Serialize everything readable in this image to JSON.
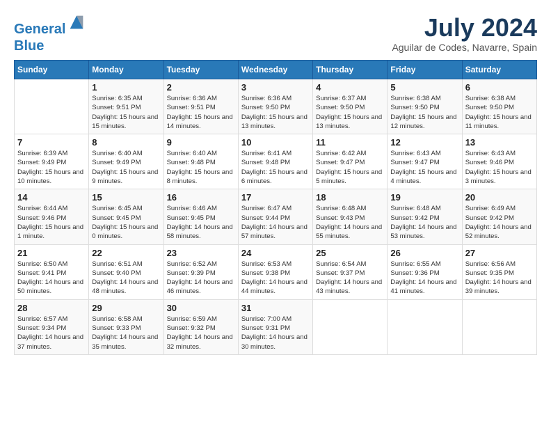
{
  "logo": {
    "line1": "General",
    "line2": "Blue"
  },
  "title": {
    "month_year": "July 2024",
    "location": "Aguilar de Codes, Navarre, Spain"
  },
  "weekdays": [
    "Sunday",
    "Monday",
    "Tuesday",
    "Wednesday",
    "Thursday",
    "Friday",
    "Saturday"
  ],
  "weeks": [
    [
      {
        "day": "",
        "sunrise": "",
        "sunset": "",
        "daylight": ""
      },
      {
        "day": "1",
        "sunrise": "Sunrise: 6:35 AM",
        "sunset": "Sunset: 9:51 PM",
        "daylight": "Daylight: 15 hours and 15 minutes."
      },
      {
        "day": "2",
        "sunrise": "Sunrise: 6:36 AM",
        "sunset": "Sunset: 9:51 PM",
        "daylight": "Daylight: 15 hours and 14 minutes."
      },
      {
        "day": "3",
        "sunrise": "Sunrise: 6:36 AM",
        "sunset": "Sunset: 9:50 PM",
        "daylight": "Daylight: 15 hours and 13 minutes."
      },
      {
        "day": "4",
        "sunrise": "Sunrise: 6:37 AM",
        "sunset": "Sunset: 9:50 PM",
        "daylight": "Daylight: 15 hours and 13 minutes."
      },
      {
        "day": "5",
        "sunrise": "Sunrise: 6:38 AM",
        "sunset": "Sunset: 9:50 PM",
        "daylight": "Daylight: 15 hours and 12 minutes."
      },
      {
        "day": "6",
        "sunrise": "Sunrise: 6:38 AM",
        "sunset": "Sunset: 9:50 PM",
        "daylight": "Daylight: 15 hours and 11 minutes."
      }
    ],
    [
      {
        "day": "7",
        "sunrise": "Sunrise: 6:39 AM",
        "sunset": "Sunset: 9:49 PM",
        "daylight": "Daylight: 15 hours and 10 minutes."
      },
      {
        "day": "8",
        "sunrise": "Sunrise: 6:40 AM",
        "sunset": "Sunset: 9:49 PM",
        "daylight": "Daylight: 15 hours and 9 minutes."
      },
      {
        "day": "9",
        "sunrise": "Sunrise: 6:40 AM",
        "sunset": "Sunset: 9:48 PM",
        "daylight": "Daylight: 15 hours and 8 minutes."
      },
      {
        "day": "10",
        "sunrise": "Sunrise: 6:41 AM",
        "sunset": "Sunset: 9:48 PM",
        "daylight": "Daylight: 15 hours and 6 minutes."
      },
      {
        "day": "11",
        "sunrise": "Sunrise: 6:42 AM",
        "sunset": "Sunset: 9:47 PM",
        "daylight": "Daylight: 15 hours and 5 minutes."
      },
      {
        "day": "12",
        "sunrise": "Sunrise: 6:43 AM",
        "sunset": "Sunset: 9:47 PM",
        "daylight": "Daylight: 15 hours and 4 minutes."
      },
      {
        "day": "13",
        "sunrise": "Sunrise: 6:43 AM",
        "sunset": "Sunset: 9:46 PM",
        "daylight": "Daylight: 15 hours and 3 minutes."
      }
    ],
    [
      {
        "day": "14",
        "sunrise": "Sunrise: 6:44 AM",
        "sunset": "Sunset: 9:46 PM",
        "daylight": "Daylight: 15 hours and 1 minute."
      },
      {
        "day": "15",
        "sunrise": "Sunrise: 6:45 AM",
        "sunset": "Sunset: 9:45 PM",
        "daylight": "Daylight: 15 hours and 0 minutes."
      },
      {
        "day": "16",
        "sunrise": "Sunrise: 6:46 AM",
        "sunset": "Sunset: 9:45 PM",
        "daylight": "Daylight: 14 hours and 58 minutes."
      },
      {
        "day": "17",
        "sunrise": "Sunrise: 6:47 AM",
        "sunset": "Sunset: 9:44 PM",
        "daylight": "Daylight: 14 hours and 57 minutes."
      },
      {
        "day": "18",
        "sunrise": "Sunrise: 6:48 AM",
        "sunset": "Sunset: 9:43 PM",
        "daylight": "Daylight: 14 hours and 55 minutes."
      },
      {
        "day": "19",
        "sunrise": "Sunrise: 6:48 AM",
        "sunset": "Sunset: 9:42 PM",
        "daylight": "Daylight: 14 hours and 53 minutes."
      },
      {
        "day": "20",
        "sunrise": "Sunrise: 6:49 AM",
        "sunset": "Sunset: 9:42 PM",
        "daylight": "Daylight: 14 hours and 52 minutes."
      }
    ],
    [
      {
        "day": "21",
        "sunrise": "Sunrise: 6:50 AM",
        "sunset": "Sunset: 9:41 PM",
        "daylight": "Daylight: 14 hours and 50 minutes."
      },
      {
        "day": "22",
        "sunrise": "Sunrise: 6:51 AM",
        "sunset": "Sunset: 9:40 PM",
        "daylight": "Daylight: 14 hours and 48 minutes."
      },
      {
        "day": "23",
        "sunrise": "Sunrise: 6:52 AM",
        "sunset": "Sunset: 9:39 PM",
        "daylight": "Daylight: 14 hours and 46 minutes."
      },
      {
        "day": "24",
        "sunrise": "Sunrise: 6:53 AM",
        "sunset": "Sunset: 9:38 PM",
        "daylight": "Daylight: 14 hours and 44 minutes."
      },
      {
        "day": "25",
        "sunrise": "Sunrise: 6:54 AM",
        "sunset": "Sunset: 9:37 PM",
        "daylight": "Daylight: 14 hours and 43 minutes."
      },
      {
        "day": "26",
        "sunrise": "Sunrise: 6:55 AM",
        "sunset": "Sunset: 9:36 PM",
        "daylight": "Daylight: 14 hours and 41 minutes."
      },
      {
        "day": "27",
        "sunrise": "Sunrise: 6:56 AM",
        "sunset": "Sunset: 9:35 PM",
        "daylight": "Daylight: 14 hours and 39 minutes."
      }
    ],
    [
      {
        "day": "28",
        "sunrise": "Sunrise: 6:57 AM",
        "sunset": "Sunset: 9:34 PM",
        "daylight": "Daylight: 14 hours and 37 minutes."
      },
      {
        "day": "29",
        "sunrise": "Sunrise: 6:58 AM",
        "sunset": "Sunset: 9:33 PM",
        "daylight": "Daylight: 14 hours and 35 minutes."
      },
      {
        "day": "30",
        "sunrise": "Sunrise: 6:59 AM",
        "sunset": "Sunset: 9:32 PM",
        "daylight": "Daylight: 14 hours and 32 minutes."
      },
      {
        "day": "31",
        "sunrise": "Sunrise: 7:00 AM",
        "sunset": "Sunset: 9:31 PM",
        "daylight": "Daylight: 14 hours and 30 minutes."
      },
      {
        "day": "",
        "sunrise": "",
        "sunset": "",
        "daylight": ""
      },
      {
        "day": "",
        "sunrise": "",
        "sunset": "",
        "daylight": ""
      },
      {
        "day": "",
        "sunrise": "",
        "sunset": "",
        "daylight": ""
      }
    ]
  ]
}
